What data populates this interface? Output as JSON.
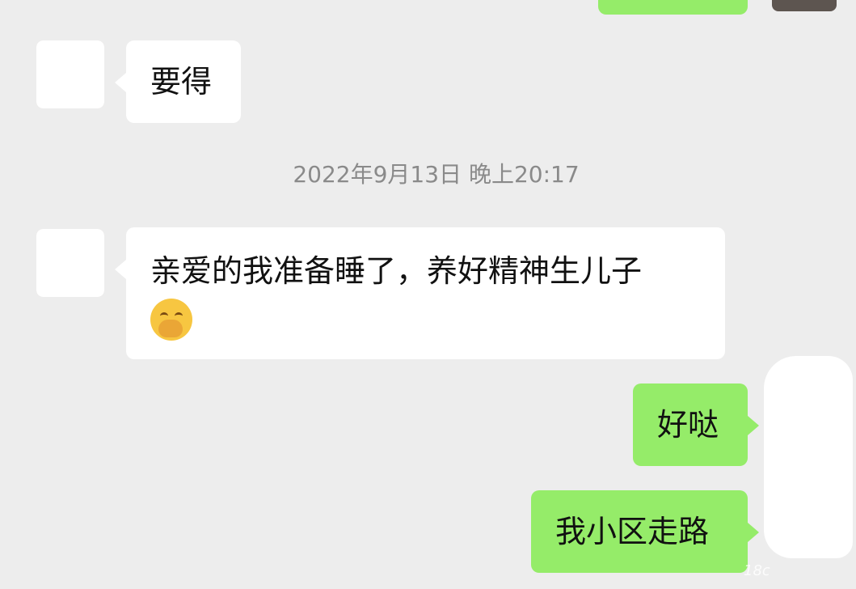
{
  "messages": [
    {
      "side": "in",
      "text": "要得"
    },
    {
      "side": "in",
      "text": "亲爱的我准备睡了，养好精神生儿子",
      "emoji": "covering-mouth-emoji"
    },
    {
      "side": "out",
      "text": "好哒"
    },
    {
      "side": "out",
      "text": "我小区走路"
    }
  ],
  "timestamp": "2022年9月13日 晚上20:17",
  "watermark": "18c",
  "colors": {
    "background": "#ededed",
    "incoming_bubble": "#ffffff",
    "outgoing_bubble": "#95ec69",
    "timestamp_text": "#8a8a8a"
  }
}
